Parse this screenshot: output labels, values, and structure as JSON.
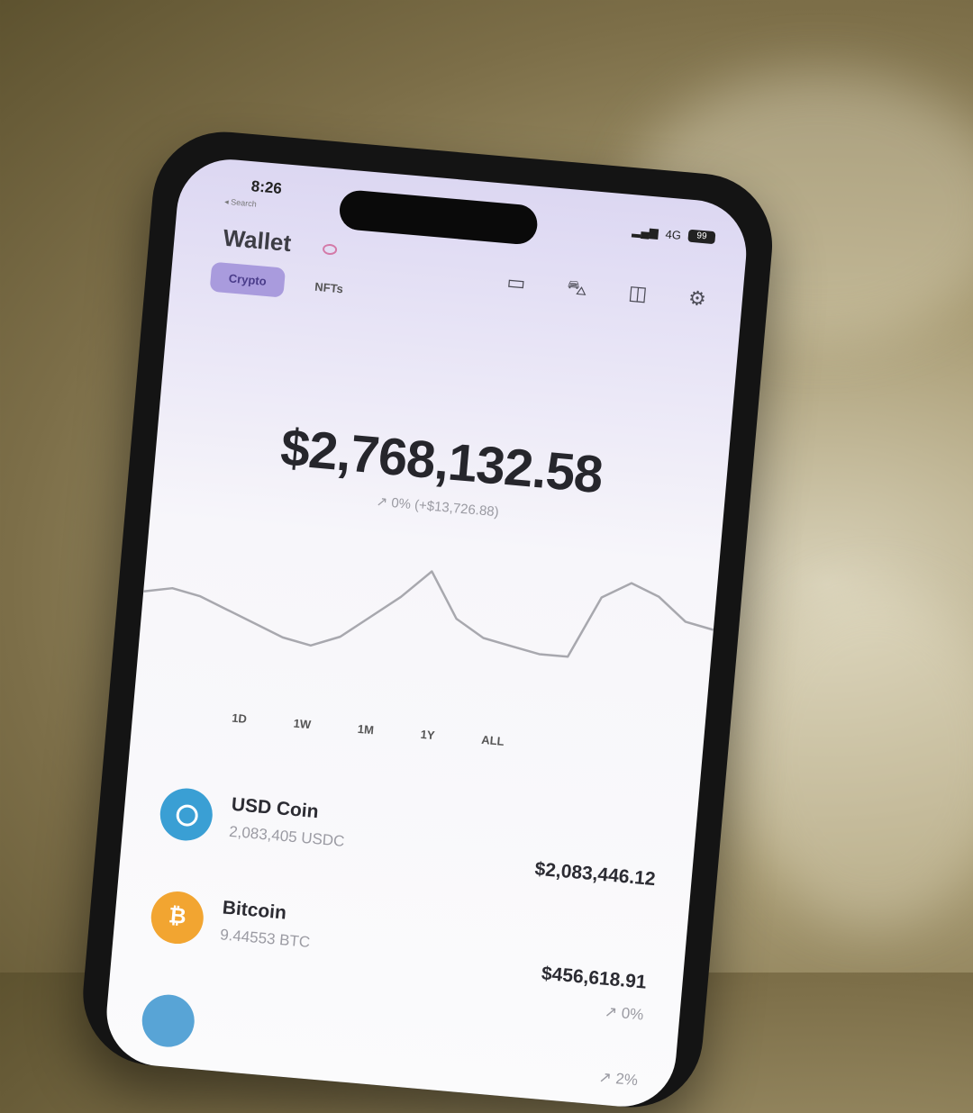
{
  "status": {
    "time": "8:26",
    "sub": "◂ Search",
    "network": "4G",
    "battery": "99"
  },
  "header": {
    "title": "Wallet",
    "icons": [
      "card-icon",
      "car-icon",
      "notification-icon",
      "settings-icon"
    ]
  },
  "tabs": [
    {
      "label": "Crypto",
      "active": true
    },
    {
      "label": "NFTs",
      "active": false
    }
  ],
  "portfolio": {
    "balance": "$2,768,132.58",
    "change": "↗ 0% (+$13,726.88)"
  },
  "chart_data": {
    "type": "line",
    "x": [
      0,
      1,
      2,
      3,
      4,
      5,
      6,
      7,
      8,
      9,
      10,
      11,
      12,
      13,
      14,
      15,
      16,
      17,
      18,
      19,
      20
    ],
    "series": [
      {
        "values": [
          52,
          53,
          52,
          50,
          48,
          46,
          45,
          47,
          51,
          55,
          60,
          52,
          49,
          48,
          47,
          47,
          58,
          61,
          59,
          55,
          54
        ]
      }
    ],
    "title": "",
    "xlabel": "",
    "ylabel": ""
  },
  "time_ranges": [
    "1D",
    "1W",
    "1M",
    "1Y",
    "ALL"
  ],
  "assets": [
    {
      "name": "USD Coin",
      "amount": "2,083,405 USDC",
      "value": "$2,083,446.12",
      "change": "",
      "coin": "usdc-icon"
    },
    {
      "name": "Bitcoin",
      "amount": "9.44553 BTC",
      "value": "$456,618.91",
      "change": "↗ 0%",
      "coin": "bitcoin-icon"
    },
    {
      "name": "",
      "amount": "",
      "value": "",
      "change": "↗ 2%",
      "coin": "ethereum-icon"
    }
  ],
  "colors": {
    "accent": "#a99bdd",
    "usdc": "#3a9fd4",
    "bitcoin": "#f2a531"
  }
}
